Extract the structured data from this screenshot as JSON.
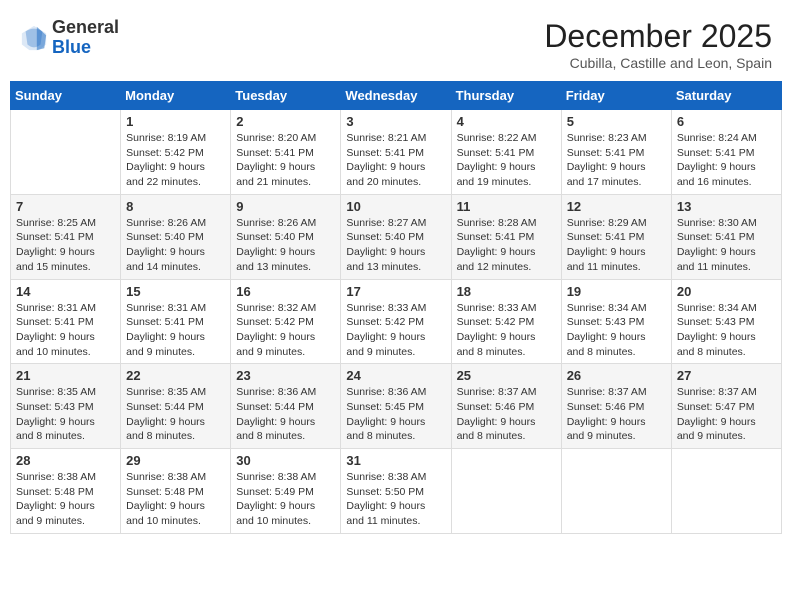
{
  "header": {
    "logo_general": "General",
    "logo_blue": "Blue",
    "month": "December 2025",
    "location": "Cubilla, Castille and Leon, Spain"
  },
  "days_of_week": [
    "Sunday",
    "Monday",
    "Tuesday",
    "Wednesday",
    "Thursday",
    "Friday",
    "Saturday"
  ],
  "weeks": [
    [
      {
        "day": "",
        "sunrise": "",
        "sunset": "",
        "daylight": ""
      },
      {
        "day": "1",
        "sunrise": "Sunrise: 8:19 AM",
        "sunset": "Sunset: 5:42 PM",
        "daylight": "Daylight: 9 hours and 22 minutes."
      },
      {
        "day": "2",
        "sunrise": "Sunrise: 8:20 AM",
        "sunset": "Sunset: 5:41 PM",
        "daylight": "Daylight: 9 hours and 21 minutes."
      },
      {
        "day": "3",
        "sunrise": "Sunrise: 8:21 AM",
        "sunset": "Sunset: 5:41 PM",
        "daylight": "Daylight: 9 hours and 20 minutes."
      },
      {
        "day": "4",
        "sunrise": "Sunrise: 8:22 AM",
        "sunset": "Sunset: 5:41 PM",
        "daylight": "Daylight: 9 hours and 19 minutes."
      },
      {
        "day": "5",
        "sunrise": "Sunrise: 8:23 AM",
        "sunset": "Sunset: 5:41 PM",
        "daylight": "Daylight: 9 hours and 17 minutes."
      },
      {
        "day": "6",
        "sunrise": "Sunrise: 8:24 AM",
        "sunset": "Sunset: 5:41 PM",
        "daylight": "Daylight: 9 hours and 16 minutes."
      }
    ],
    [
      {
        "day": "7",
        "sunrise": "Sunrise: 8:25 AM",
        "sunset": "Sunset: 5:41 PM",
        "daylight": "Daylight: 9 hours and 15 minutes."
      },
      {
        "day": "8",
        "sunrise": "Sunrise: 8:26 AM",
        "sunset": "Sunset: 5:40 PM",
        "daylight": "Daylight: 9 hours and 14 minutes."
      },
      {
        "day": "9",
        "sunrise": "Sunrise: 8:26 AM",
        "sunset": "Sunset: 5:40 PM",
        "daylight": "Daylight: 9 hours and 13 minutes."
      },
      {
        "day": "10",
        "sunrise": "Sunrise: 8:27 AM",
        "sunset": "Sunset: 5:40 PM",
        "daylight": "Daylight: 9 hours and 13 minutes."
      },
      {
        "day": "11",
        "sunrise": "Sunrise: 8:28 AM",
        "sunset": "Sunset: 5:41 PM",
        "daylight": "Daylight: 9 hours and 12 minutes."
      },
      {
        "day": "12",
        "sunrise": "Sunrise: 8:29 AM",
        "sunset": "Sunset: 5:41 PM",
        "daylight": "Daylight: 9 hours and 11 minutes."
      },
      {
        "day": "13",
        "sunrise": "Sunrise: 8:30 AM",
        "sunset": "Sunset: 5:41 PM",
        "daylight": "Daylight: 9 hours and 11 minutes."
      }
    ],
    [
      {
        "day": "14",
        "sunrise": "Sunrise: 8:31 AM",
        "sunset": "Sunset: 5:41 PM",
        "daylight": "Daylight: 9 hours and 10 minutes."
      },
      {
        "day": "15",
        "sunrise": "Sunrise: 8:31 AM",
        "sunset": "Sunset: 5:41 PM",
        "daylight": "Daylight: 9 hours and 9 minutes."
      },
      {
        "day": "16",
        "sunrise": "Sunrise: 8:32 AM",
        "sunset": "Sunset: 5:42 PM",
        "daylight": "Daylight: 9 hours and 9 minutes."
      },
      {
        "day": "17",
        "sunrise": "Sunrise: 8:33 AM",
        "sunset": "Sunset: 5:42 PM",
        "daylight": "Daylight: 9 hours and 9 minutes."
      },
      {
        "day": "18",
        "sunrise": "Sunrise: 8:33 AM",
        "sunset": "Sunset: 5:42 PM",
        "daylight": "Daylight: 9 hours and 8 minutes."
      },
      {
        "day": "19",
        "sunrise": "Sunrise: 8:34 AM",
        "sunset": "Sunset: 5:43 PM",
        "daylight": "Daylight: 9 hours and 8 minutes."
      },
      {
        "day": "20",
        "sunrise": "Sunrise: 8:34 AM",
        "sunset": "Sunset: 5:43 PM",
        "daylight": "Daylight: 9 hours and 8 minutes."
      }
    ],
    [
      {
        "day": "21",
        "sunrise": "Sunrise: 8:35 AM",
        "sunset": "Sunset: 5:43 PM",
        "daylight": "Daylight: 9 hours and 8 minutes."
      },
      {
        "day": "22",
        "sunrise": "Sunrise: 8:35 AM",
        "sunset": "Sunset: 5:44 PM",
        "daylight": "Daylight: 9 hours and 8 minutes."
      },
      {
        "day": "23",
        "sunrise": "Sunrise: 8:36 AM",
        "sunset": "Sunset: 5:44 PM",
        "daylight": "Daylight: 9 hours and 8 minutes."
      },
      {
        "day": "24",
        "sunrise": "Sunrise: 8:36 AM",
        "sunset": "Sunset: 5:45 PM",
        "daylight": "Daylight: 9 hours and 8 minutes."
      },
      {
        "day": "25",
        "sunrise": "Sunrise: 8:37 AM",
        "sunset": "Sunset: 5:46 PM",
        "daylight": "Daylight: 9 hours and 8 minutes."
      },
      {
        "day": "26",
        "sunrise": "Sunrise: 8:37 AM",
        "sunset": "Sunset: 5:46 PM",
        "daylight": "Daylight: 9 hours and 9 minutes."
      },
      {
        "day": "27",
        "sunrise": "Sunrise: 8:37 AM",
        "sunset": "Sunset: 5:47 PM",
        "daylight": "Daylight: 9 hours and 9 minutes."
      }
    ],
    [
      {
        "day": "28",
        "sunrise": "Sunrise: 8:38 AM",
        "sunset": "Sunset: 5:48 PM",
        "daylight": "Daylight: 9 hours and 9 minutes."
      },
      {
        "day": "29",
        "sunrise": "Sunrise: 8:38 AM",
        "sunset": "Sunset: 5:48 PM",
        "daylight": "Daylight: 9 hours and 10 minutes."
      },
      {
        "day": "30",
        "sunrise": "Sunrise: 8:38 AM",
        "sunset": "Sunset: 5:49 PM",
        "daylight": "Daylight: 9 hours and 10 minutes."
      },
      {
        "day": "31",
        "sunrise": "Sunrise: 8:38 AM",
        "sunset": "Sunset: 5:50 PM",
        "daylight": "Daylight: 9 hours and 11 minutes."
      },
      {
        "day": "",
        "sunrise": "",
        "sunset": "",
        "daylight": ""
      },
      {
        "day": "",
        "sunrise": "",
        "sunset": "",
        "daylight": ""
      },
      {
        "day": "",
        "sunrise": "",
        "sunset": "",
        "daylight": ""
      }
    ]
  ]
}
